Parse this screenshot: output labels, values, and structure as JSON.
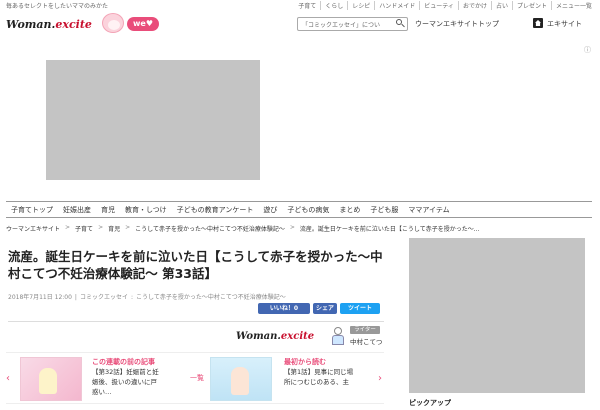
{
  "topbar": {
    "tagline": "毎あるセレクトをしたいママのみかた",
    "nav": [
      "子育て",
      "くらし",
      "レシピ",
      "ハンドメイド",
      "ビューティ",
      "おでかけ",
      "占い",
      "プレゼント",
      "メニュー一覧"
    ]
  },
  "header": {
    "logo_main": "Woman.",
    "logo_ex": "excite",
    "we_label": "we♥",
    "search_value": "「コミックエッセイ」につい",
    "top_link": "ウーマンエキサイトトップ",
    "excite_link": "エキサイト"
  },
  "ad": {
    "choice_icon": "ⓘ"
  },
  "category_nav": [
    "子育てトップ",
    "妊娠出産",
    "育児",
    "教育・しつけ",
    "子どもの教育アンケート",
    "遊び",
    "子どもの病気",
    "まとめ",
    "子ども服",
    "ママアイテム"
  ],
  "breadcrumbs": [
    "ウーマンエキサイト",
    "子育て",
    "育児",
    "こうして赤子を授かった〜中村こてつ不妊治療体験記〜",
    "流産。誕生日ケーキを前に泣いた日【こうして赤子を授かった〜..."
  ],
  "article": {
    "title": "流産。誕生日ケーキを前に泣いた日【こうして赤子を授かった〜中村こてつ不妊治療体験記〜 第33話】",
    "date": "2018年7月11日 12:00",
    "category": "コミックエッセイ",
    "series": "こうして赤子を授かった〜中村こてつ不妊治療体験記〜",
    "like_label": "いいね！0",
    "share_label": "シェア",
    "tweet_label": "ツイート"
  },
  "author": {
    "brand_main": "Woman.",
    "brand_ex": "excite",
    "badge": "ライター",
    "name": "中村こてつ"
  },
  "series_nav": {
    "prev_arrow": "‹",
    "next_arrow": "›",
    "prev_head": "この連載の前の記事",
    "prev_title": "【第32話】妊娠前と妊娠後、扱いの違いに戸惑い…",
    "list_label": "一覧",
    "first_head": "最初から読む",
    "first_title": "【第1話】見事に同じ場所につむじのある、主"
  },
  "sidebar": {
    "pickup": "ピックアップ"
  }
}
